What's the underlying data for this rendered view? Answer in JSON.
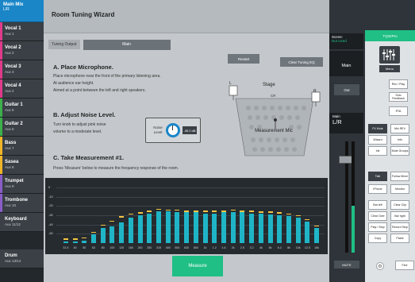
{
  "left_strip": {
    "mix_name": "Main Mix",
    "mix_sub": "L/R",
    "channels": [
      {
        "name": "Vocal 1",
        "sub": "Aux 1",
        "color": "#e03a8a"
      },
      {
        "name": "Vocal 2",
        "sub": "Aux 2",
        "color": "#e03a8a"
      },
      {
        "name": "Vocal 3",
        "sub": "Aux 3",
        "color": "#e03a8a"
      },
      {
        "name": "Vocal 4",
        "sub": "Aux 4",
        "color": "#e03a8a"
      },
      {
        "name": "Guitar 1",
        "sub": "Aux 5",
        "color": "#3cb04a"
      },
      {
        "name": "Guitar 2",
        "sub": "Aux 6",
        "color": "#3cb04a"
      },
      {
        "name": "Bass",
        "sub": "Aux 7",
        "color": "#f0b429"
      },
      {
        "name": "Sasea",
        "sub": "Aux 8",
        "color": "#f0b429"
      },
      {
        "name": "Trumpet",
        "sub": "Aux 9",
        "color": "#8a5cc8"
      },
      {
        "name": "Trombone",
        "sub": "Aux 10",
        "color": "#8a5cc8"
      },
      {
        "name": "Keyboard",
        "sub": "Aux 11/12",
        "color": "#3a4046"
      },
      {
        "name": "Drum",
        "sub": "Aux 13/14",
        "color": "#3a4046"
      }
    ]
  },
  "wizard": {
    "title": "Room Tuning Wizard",
    "tuning_output_label": "Tuning Output",
    "tuning_output_value": "Main",
    "restart_label": "Restart",
    "clear_label": "Clear Tuning EQ",
    "sections": [
      {
        "heading": "A. Place Microphone.",
        "lines": [
          "Place microphone near the front of the primary listening area.",
          "At audience ear height.",
          "Aimed at a point between the left and right speakers."
        ]
      },
      {
        "heading": "B. Adjust Noise Level.",
        "lines": [
          "Turn knob to adjust pink noise",
          "volume to a moderate level."
        ]
      },
      {
        "heading": "C. Take Measurement #1.",
        "lines": [
          "Press 'Measure' below to measure the frequency response of the room."
        ]
      }
    ],
    "noise_label": "Noise Level",
    "noise_value": "-35.0 dB",
    "stage_label": "Stage",
    "stage_ch": "CR",
    "mic_left": "L",
    "mic_right": "R",
    "measurement_mic_label": "Measurement Mic",
    "measure_label": "Measure"
  },
  "chart_data": {
    "type": "bar",
    "ylabels": [
      "0",
      "-10",
      "-20",
      "-30",
      "-40",
      "-50"
    ],
    "categories": [
      "31.5",
      "40",
      "50",
      "63",
      "80",
      "100",
      "125",
      "160",
      "200",
      "250",
      "315",
      "400",
      "500",
      "630",
      "800",
      "1k",
      "1.2",
      "1.6",
      "2k",
      "2.5",
      "3.2",
      "4k",
      "5k",
      "6.3",
      "8k",
      "10k",
      "12.5",
      "16k"
    ],
    "values": [
      -58,
      -58,
      -57,
      -51,
      -44,
      -42,
      -38,
      -33,
      -30,
      -28,
      -26,
      -26,
      -27,
      -27,
      -27,
      -28,
      -28,
      -27,
      -27,
      -27,
      -28,
      -28,
      -29,
      -30,
      -31,
      -33,
      -37,
      -44
    ],
    "peaks": [
      -55,
      -55,
      -54,
      -48,
      -40,
      -36,
      -31,
      -28,
      -27,
      -25,
      -23,
      -24,
      -24,
      -25,
      -25,
      -25,
      -25,
      -25,
      -24,
      -25,
      -25,
      -26,
      -26,
      -27,
      -28,
      -30,
      -34,
      -41
    ],
    "ylim": [
      -60,
      5
    ]
  },
  "master": {
    "scene_label": "Scene:",
    "scene_value": "Not Used",
    "main_label": "Main",
    "out_label": "Out",
    "fader_main": "Main",
    "fader_lr": "L/R",
    "mute_label": "MUTE",
    "meter_level": 0.42
  },
  "right_panel": {
    "header": "TQ32Pro",
    "menu_label": "Menu",
    "buttons": [
      "Rec / Play",
      "Solo Feedback",
      "RTA",
      "FX Mute",
      "Mix REV",
      "Wizard",
      "Info",
      "Init",
      "Mute Groups",
      "Talk",
      "Follow Mixer",
      "iPhone",
      "Monitor",
      "Bar left",
      "Clear Clip",
      "Clear Over",
      "Bar right",
      "Play / Stop",
      "Record Stop",
      "Copy",
      "Paste",
      "Fine"
    ],
    "colors": {
      "accent": "#1fbf85",
      "blue": "#1a86c8"
    }
  }
}
